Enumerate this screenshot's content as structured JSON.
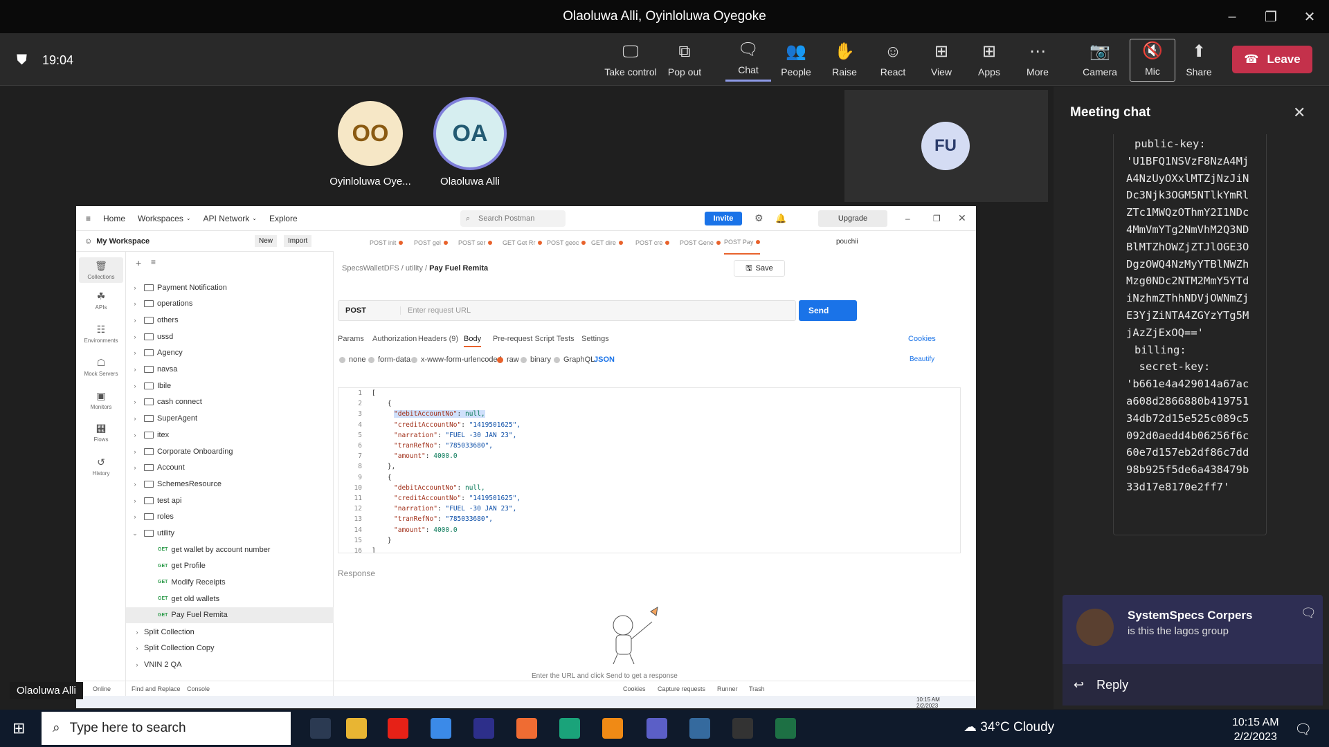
{
  "window": {
    "title": "Olaoluwa Alli, Oyinloluwa Oyegoke"
  },
  "meeting": {
    "timer": "19:04",
    "toolbar": [
      {
        "label": "Take control",
        "icon": "screen-control-icon"
      },
      {
        "label": "Pop out",
        "icon": "pop-out-icon"
      },
      {
        "label": "Chat",
        "icon": "chat-icon"
      },
      {
        "label": "People",
        "icon": "people-icon"
      },
      {
        "label": "Raise",
        "icon": "hand-icon"
      },
      {
        "label": "React",
        "icon": "smile-icon"
      },
      {
        "label": "View",
        "icon": "grid-icon"
      },
      {
        "label": "Apps",
        "icon": "plus-icon"
      },
      {
        "label": "More",
        "icon": "ellipsis-icon"
      },
      {
        "label": "Camera",
        "icon": "camera-off-icon"
      },
      {
        "label": "Mic",
        "icon": "mic-off-icon"
      },
      {
        "label": "Share",
        "icon": "share-icon"
      }
    ],
    "leave_label": "Leave",
    "participants": [
      {
        "initials": "OO",
        "name": "Oyinloluwa Oye..."
      },
      {
        "initials": "OA",
        "name": "Olaoluwa Alli"
      },
      {
        "initials": "FU",
        "name": ""
      }
    ],
    "presenter_label": "Olaoluwa Alli"
  },
  "chat": {
    "title": "Meeting chat",
    "code_lines": [
      "public-key:",
      "'U1BFQ1NSVzF8NzA4Mj",
      "A4NzUyOXxlMTZjNzJiN",
      "Dc3Njk3OGM5NTlkYmRl",
      "ZTc1MWQzOThmY2I1NDc",
      "4MmVmYTg2NmVhM2Q3ND",
      "BlMTZhOWZjZTJlOGE3O",
      "DgzOWQ4NzMyYTBlNWZh",
      "Mzg0NDc2NTM2MmY5YTd",
      "iNzhmZThhNDVjOWNmZj",
      "E3YjZiNTA4ZGYzYTg5M",
      "jAzZjExOQ=='",
      "",
      "billing:",
      "  secret-key:",
      "'b661e4a429014a67ac",
      "a608d2866880b419751",
      "34db72d15e525c089c5",
      "092d0aedd4b06256f6c",
      "60e7d157eb2df86c7dd",
      "98b925f5de6a438479b",
      "33d17e8170e2ff7'"
    ],
    "message": {
      "sender": "SystemSpecs Corpers",
      "text": "is this the lagos group"
    },
    "reply_label": "Reply"
  },
  "postman": {
    "nav": [
      "Home",
      "Workspaces",
      "API Network",
      "Explore"
    ],
    "search_placeholder": "Search Postman",
    "invite": "Invite",
    "upgrade": "Upgrade",
    "workspace": "My Workspace",
    "new_label": "New",
    "import_label": "Import",
    "left_nav": [
      "Collections",
      "APIs",
      "Environments",
      "Mock Servers",
      "Monitors",
      "Flows",
      "History"
    ],
    "tree": [
      "Payment Notification",
      "operations",
      "others",
      "ussd",
      "Agency",
      "navsa",
      "Ibile",
      "cash connect",
      "SuperAgent",
      "itex",
      "Corporate Onboarding",
      "Account",
      "SchemesResource",
      "test api",
      "roles",
      "utility"
    ],
    "utility_items": [
      "get wallet by account number",
      "get Profile",
      "Modify Receipts",
      "get old wallets",
      "Pay Fuel Remita"
    ],
    "bottom_tree": [
      "Split Collection",
      "Split Collection Copy",
      "VNIN 2 QA"
    ],
    "tabs": [
      "POST init",
      "POST gel",
      "POST ser",
      "GET Get Rr",
      "POST geoc",
      "GET dire",
      "POST cre",
      "POST Gene",
      "POST Pay"
    ],
    "env": "pouchii",
    "breadcrumb": [
      "SpecsWalletDFS",
      "utility",
      "Pay Fuel Remita"
    ],
    "save_label": "Save",
    "method": "POST",
    "url_placeholder": "Enter request URL",
    "send_label": "Send",
    "req_tabs": [
      "Params",
      "Authorization",
      "Headers (9)",
      "Body",
      "Pre-request Script",
      "Tests",
      "Settings"
    ],
    "cookies": "Cookies",
    "body_types": [
      "none",
      "form-data",
      "x-www-form-urlencoded",
      "raw",
      "binary",
      "GraphQL"
    ],
    "body_format": "JSON",
    "beautify": "Beautify",
    "response_label": "Response",
    "empty_text": "Enter the URL and click Send to get a response",
    "status_items": [
      "Online",
      "Find and Replace",
      "Console",
      "Cookies",
      "Capture requests",
      "Runner",
      "Trash"
    ],
    "inner_clock": "10:15 AM\n2/2/2023",
    "code": [
      {
        "n": "1",
        "t": "["
      },
      {
        "n": "2",
        "t": "    {"
      },
      {
        "n": "3",
        "k": "\"debitAccountNo\"",
        "v": " null,",
        "vt": "n",
        "hl": true
      },
      {
        "n": "4",
        "k": "\"creditAccountNo\"",
        "v": " \"1419501625\",",
        "vt": "s"
      },
      {
        "n": "5",
        "k": "\"narration\"",
        "v": " \"FUEL -30 JAN 23\",",
        "vt": "s"
      },
      {
        "n": "6",
        "k": "\"tranRefNo\"",
        "v": " \"785033680\",",
        "vt": "s"
      },
      {
        "n": "7",
        "k": "\"amount\"",
        "v": " 4000.0",
        "vt": "n"
      },
      {
        "n": "8",
        "t": "    },"
      },
      {
        "n": "9",
        "t": "    {"
      },
      {
        "n": "10",
        "k": "\"debitAccountNo\"",
        "v": " null,",
        "vt": "n"
      },
      {
        "n": "11",
        "k": "\"creditAccountNo\"",
        "v": " \"1419501625\",",
        "vt": "s"
      },
      {
        "n": "12",
        "k": "\"narration\"",
        "v": " \"FUEL -30 JAN 23\",",
        "vt": "s"
      },
      {
        "n": "13",
        "k": "\"tranRefNo\"",
        "v": " \"785033680\",",
        "vt": "s"
      },
      {
        "n": "14",
        "k": "\"amount\"",
        "v": " 4000.0",
        "vt": "n"
      },
      {
        "n": "15",
        "t": "    }"
      },
      {
        "n": "16",
        "t": "]"
      }
    ]
  },
  "taskbar": {
    "search_placeholder": "Type here to search",
    "weather": "34°C  Cloudy",
    "time": "10:15 AM",
    "date": "2/2/2023"
  }
}
